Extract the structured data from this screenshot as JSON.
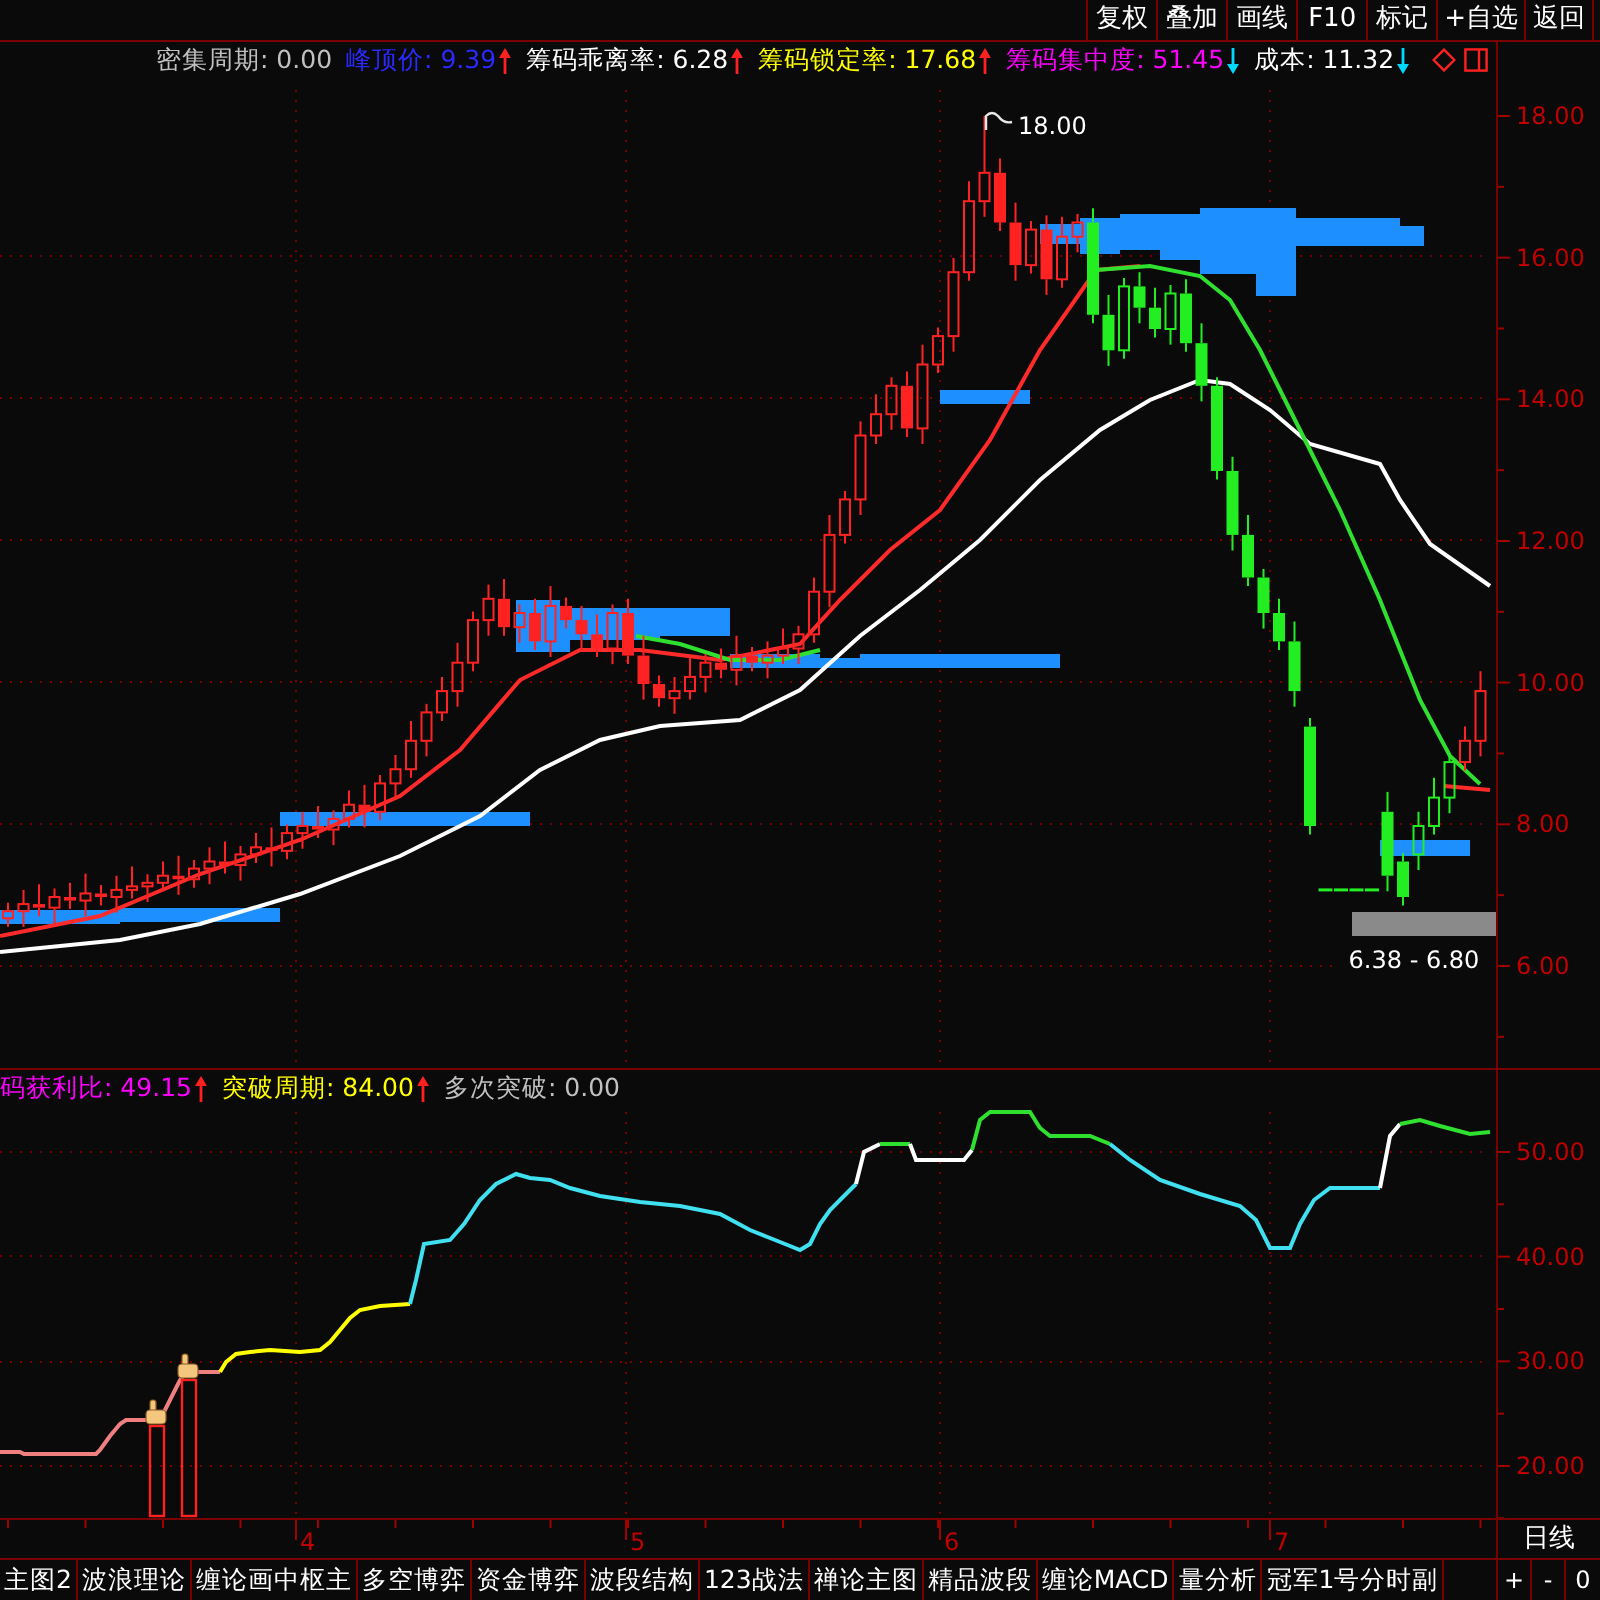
{
  "toolbar": {
    "buttons": [
      "复权",
      "叠加",
      "画线",
      "F10",
      "标记",
      "+自选",
      "返回"
    ]
  },
  "main_chart": {
    "indicators": [
      {
        "text": "密集周期: 0.00",
        "color": "#c0c0c0"
      },
      {
        "text": "峰顶价: 9.39",
        "color": "#2a2aff",
        "rising": true
      },
      {
        "text": "筹码乖离率: 6.28",
        "color": "#ffffff",
        "rising": true
      },
      {
        "text": "筹码锁定率: 17.68",
        "color": "#ffff00",
        "rising": true
      },
      {
        "text": "筹码集中度: 51.45",
        "color": "#ff00ff",
        "rising": false
      },
      {
        "text": "成本: 11.32",
        "color": "#ffffff",
        "rising": false
      }
    ],
    "y_axis_labels": [
      "18.00",
      "16.00",
      "14.00",
      "12.00",
      "10.00",
      "8.00",
      "6.00"
    ],
    "peak_label": "18.00",
    "range_label": "6.38 - 6.80"
  },
  "sub_chart": {
    "indicators": [
      {
        "text": "码获利比: 49.15",
        "color": "#ff00ff",
        "rising": true
      },
      {
        "text": "突破周期: 84.00",
        "color": "#ffff00",
        "rising": true
      },
      {
        "text": "多次突破: 0.00",
        "color": "#c0c0c0"
      }
    ],
    "y_axis_labels": [
      "50.00",
      "40.00",
      "30.00",
      "20.00"
    ]
  },
  "x_axis": {
    "labels": [
      "4",
      "5",
      "6",
      "7"
    ],
    "period": "日线"
  },
  "bottom_tabs": [
    {
      "label": "主图2",
      "selected": false
    },
    {
      "label": "波浪理论",
      "selected": false
    },
    {
      "label": "缠论画中枢主",
      "selected": false
    },
    {
      "label": "多空博弈",
      "selected": false
    },
    {
      "label": "资金博弈",
      "selected": false
    },
    {
      "label": "波段结构",
      "selected": false
    },
    {
      "label": "123战法",
      "selected": false
    },
    {
      "label": "禅论主图",
      "selected": false
    },
    {
      "label": "精品波段",
      "selected": false
    },
    {
      "label": "缠论MACD",
      "selected": false
    },
    {
      "label": "量分析",
      "selected": false
    },
    {
      "label": "冠军1号分时副",
      "selected": false
    }
  ],
  "zoom_buttons": [
    "+",
    "-",
    "0"
  ]
}
